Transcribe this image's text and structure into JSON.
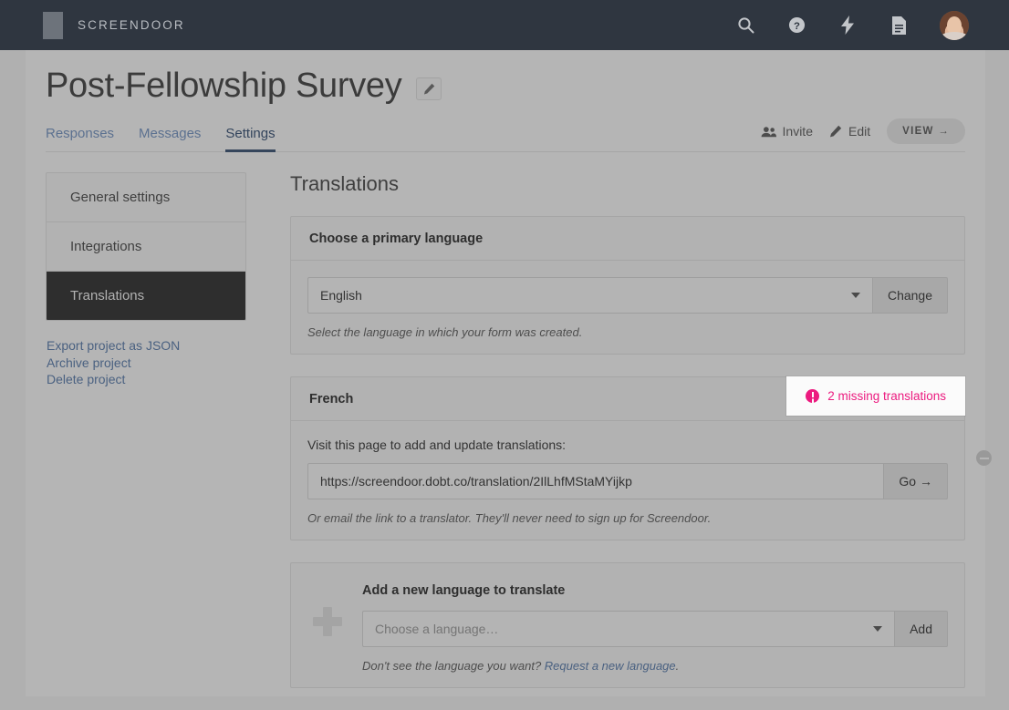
{
  "topbar": {
    "brand": "SCREENDOOR",
    "icons": [
      {
        "name": "search-icon",
        "label": "Search"
      },
      {
        "name": "help-icon",
        "label": "Help"
      },
      {
        "name": "bolt-icon",
        "label": "Activity"
      },
      {
        "name": "document-icon",
        "label": "Documents"
      }
    ],
    "avatar_label": "User account"
  },
  "header": {
    "title": "Post-Fellowship Survey",
    "edit_title_icon": "pencil-icon",
    "tabs": [
      {
        "label": "Responses",
        "active": false
      },
      {
        "label": "Messages",
        "active": false
      },
      {
        "label": "Settings",
        "active": true
      }
    ],
    "actions": {
      "invite_label": "Invite",
      "edit_label": "Edit",
      "view_label": "VIEW →"
    }
  },
  "sidebar": {
    "items": [
      {
        "label": "General settings",
        "active": false
      },
      {
        "label": "Integrations",
        "active": false
      },
      {
        "label": "Translations",
        "active": true
      }
    ],
    "links": [
      {
        "label": "Export project as JSON"
      },
      {
        "label": "Archive project"
      },
      {
        "label": "Delete project"
      }
    ]
  },
  "main": {
    "section_title": "Translations",
    "primary_language_card": {
      "heading": "Choose a primary language",
      "selected_language": "English",
      "change_label": "Change",
      "helper": "Select the language in which your form was created."
    },
    "french_card": {
      "heading": "French",
      "missing_badge": "2 missing translations",
      "missing_badge_color": "#ec1a7f",
      "body_label": "Visit this page to add and update translations:",
      "url": "https://screendoor.dobt.co/translation/2IlLhfMStaMYijkp",
      "go_label": "Go →",
      "helper": "Or email the link to a translator. They'll never need to sign up for Screendoor.",
      "remove_icon": "minus-circle-icon"
    },
    "add_language_card": {
      "plus_icon": "plus-icon",
      "heading": "Add a new language to translate",
      "placeholder": "Choose a language…",
      "add_label": "Add",
      "helper_prefix": "Don't see the language you want? ",
      "helper_link": "Request a new language",
      "helper_suffix": "."
    }
  }
}
